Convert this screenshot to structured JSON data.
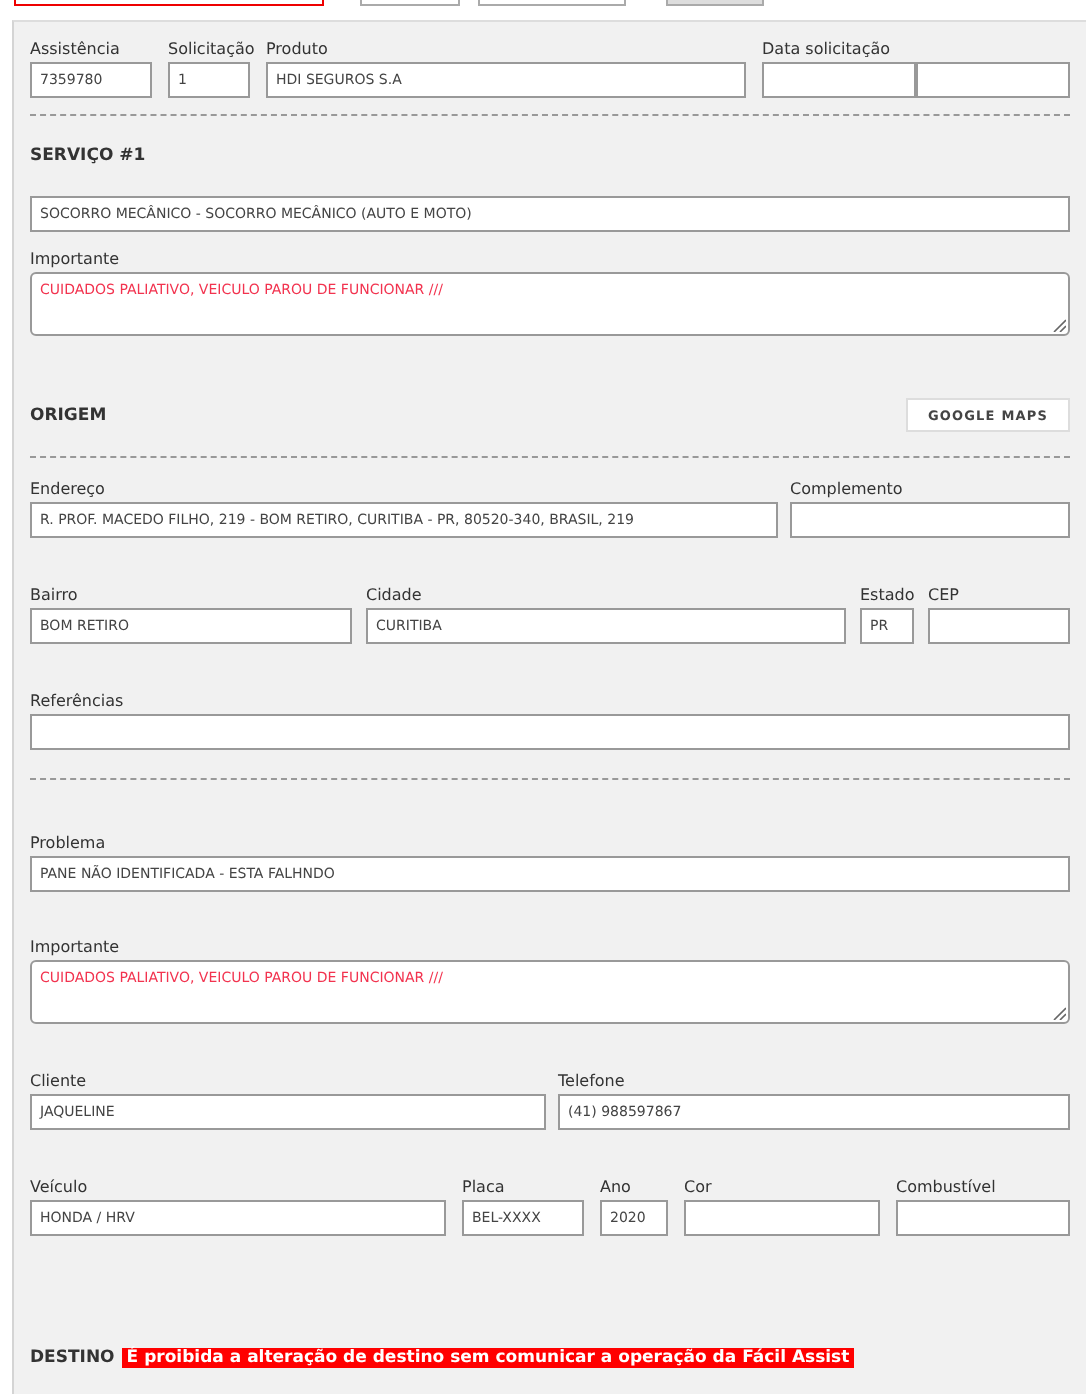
{
  "top_bar": [
    {
      "kind": "alert-field"
    },
    {
      "kind": "field"
    },
    {
      "kind": "field"
    },
    {
      "kind": "button"
    }
  ],
  "blocks": [
    {
      "kind": "fields",
      "fields": [
        {
          "kind": "input",
          "label": "Assistência",
          "value": "7359780"
        },
        {
          "kind": "input",
          "label": "Solicitação",
          "value": "1"
        },
        {
          "kind": "input",
          "label": "Produto",
          "value": "HDI SEGUROS S.A"
        },
        {
          "kind": "split",
          "label": "Data solicitação"
        }
      ]
    },
    {
      "kind": "divider"
    },
    {
      "kind": "heading",
      "title": "SERVIÇO #1"
    },
    {
      "kind": "fields",
      "fields": [
        {
          "kind": "input",
          "value": "SOCORRO MECÂNICO - SOCORRO MECÂNICO (AUTO E MOTO)"
        }
      ]
    },
    {
      "kind": "fields",
      "fields": [
        {
          "kind": "textarea",
          "label": "Importante",
          "value": "CUIDADOS PALIATIVO, VEICULO PAROU DE FUNCIONAR ///"
        }
      ]
    },
    {
      "kind": "heading",
      "title": "ORIGEM",
      "button": "GOOGLE MAPS"
    },
    {
      "kind": "divider"
    },
    {
      "kind": "fields",
      "fields": [
        {
          "kind": "input",
          "label": "Endereço",
          "value": "R. PROF. MACEDO FILHO, 219 - BOM RETIRO, CURITIBA - PR, 80520-340, BRASIL, 219"
        },
        {
          "kind": "input",
          "label": "Complemento"
        }
      ]
    },
    {
      "kind": "fields",
      "fields": [
        {
          "kind": "input",
          "label": "Bairro",
          "value": "BOM RETIRO"
        },
        {
          "kind": "input",
          "label": "Cidade",
          "value": "CURITIBA"
        },
        {
          "kind": "input",
          "label": "Estado",
          "value": "PR"
        },
        {
          "kind": "input",
          "label": "CEP"
        }
      ]
    },
    {
      "kind": "fields",
      "fields": [
        {
          "kind": "input",
          "label": "Referências"
        }
      ]
    },
    {
      "kind": "divider"
    },
    {
      "kind": "fields",
      "fields": [
        {
          "kind": "input",
          "label": "Problema",
          "value": "PANE NÃO IDENTIFICADA - ESTA FALHNDO"
        }
      ]
    },
    {
      "kind": "fields",
      "fields": [
        {
          "kind": "textarea",
          "label": "Importante",
          "value": "CUIDADOS PALIATIVO, VEICULO PAROU DE FUNCIONAR ///"
        }
      ]
    },
    {
      "kind": "fields",
      "fields": [
        {
          "kind": "input",
          "label": "Cliente",
          "value": "JAQUELINE"
        },
        {
          "kind": "input",
          "label": "Telefone",
          "value": "(41) 988597867"
        }
      ]
    },
    {
      "kind": "fields",
      "fields": [
        {
          "kind": "input",
          "label": "Veículo",
          "value": "HONDA / HRV"
        },
        {
          "kind": "input",
          "label": "Placa",
          "value": "BEL-XXXX"
        },
        {
          "kind": "input",
          "label": "Ano",
          "value": "2020"
        },
        {
          "kind": "input",
          "label": "Cor"
        },
        {
          "kind": "input",
          "label": "Combustível"
        }
      ]
    },
    {
      "kind": "heading",
      "title": "DESTINO",
      "alert": "É proibida a alteração de destino sem comunicar a operação da Fácil Assist"
    }
  ]
}
